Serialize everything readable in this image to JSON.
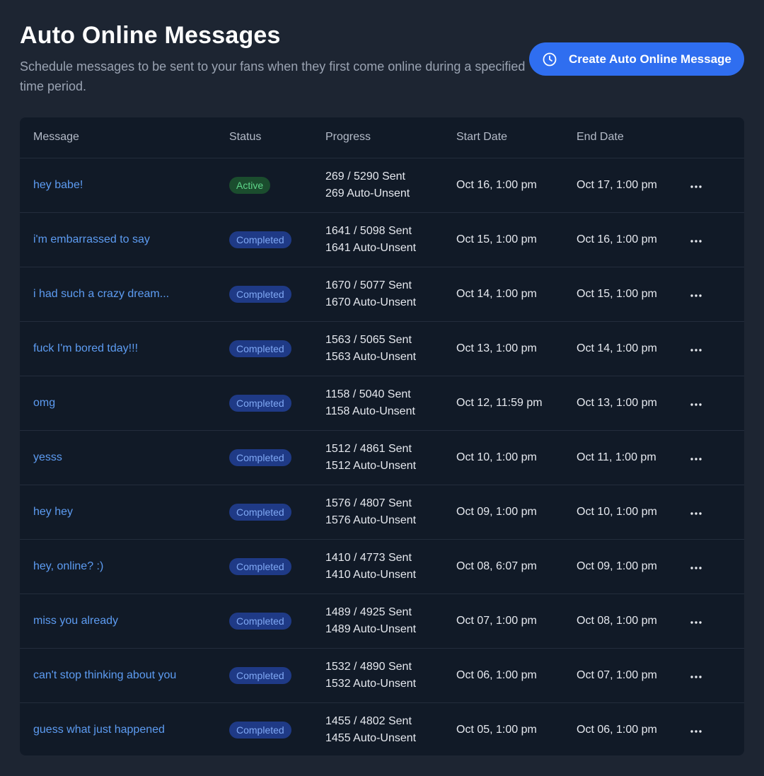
{
  "header": {
    "title": "Auto Online Messages",
    "subtitle": "Schedule messages to be sent to your fans when they first come online during a specified time period.",
    "create_button_label": "Create Auto Online Message"
  },
  "colors": {
    "accent": "#2f6ef0",
    "link": "#5d9cf2",
    "active_bg": "#1b4d2e",
    "active_text": "#5fd68a",
    "completed_bg": "#1f3a86",
    "completed_text": "#7fa8f4"
  },
  "table": {
    "columns": [
      "Message",
      "Status",
      "Progress",
      "Start Date",
      "End Date"
    ],
    "rows": [
      {
        "message": "hey babe!",
        "status": "Active",
        "sent": "269 / 5290 Sent",
        "unsent": "269 Auto-Unsent",
        "start": "Oct 16, 1:00 pm",
        "end": "Oct 17, 1:00 pm"
      },
      {
        "message": "i'm embarrassed to say",
        "status": "Completed",
        "sent": "1641 / 5098 Sent",
        "unsent": "1641 Auto-Unsent",
        "start": "Oct 15, 1:00 pm",
        "end": "Oct 16, 1:00 pm"
      },
      {
        "message": "i had such a crazy dream...",
        "status": "Completed",
        "sent": "1670 / 5077 Sent",
        "unsent": "1670 Auto-Unsent",
        "start": "Oct 14, 1:00 pm",
        "end": "Oct 15, 1:00 pm"
      },
      {
        "message": "fuck I'm bored tday!!!",
        "status": "Completed",
        "sent": "1563 / 5065 Sent",
        "unsent": "1563 Auto-Unsent",
        "start": "Oct 13, 1:00 pm",
        "end": "Oct 14, 1:00 pm"
      },
      {
        "message": "omg",
        "status": "Completed",
        "sent": "1158 / 5040 Sent",
        "unsent": "1158 Auto-Unsent",
        "start": "Oct 12, 11:59 pm",
        "end": "Oct 13, 1:00 pm"
      },
      {
        "message": "yesss",
        "status": "Completed",
        "sent": "1512 / 4861 Sent",
        "unsent": "1512 Auto-Unsent",
        "start": "Oct 10, 1:00 pm",
        "end": "Oct 11, 1:00 pm"
      },
      {
        "message": "hey hey",
        "status": "Completed",
        "sent": "1576 / 4807 Sent",
        "unsent": "1576 Auto-Unsent",
        "start": "Oct 09, 1:00 pm",
        "end": "Oct 10, 1:00 pm"
      },
      {
        "message": "hey, online? :)",
        "status": "Completed",
        "sent": "1410 / 4773 Sent",
        "unsent": "1410 Auto-Unsent",
        "start": "Oct 08, 6:07 pm",
        "end": "Oct 09, 1:00 pm"
      },
      {
        "message": "miss you already",
        "status": "Completed",
        "sent": "1489 / 4925 Sent",
        "unsent": "1489 Auto-Unsent",
        "start": "Oct 07, 1:00 pm",
        "end": "Oct 08, 1:00 pm"
      },
      {
        "message": "can't stop thinking about you",
        "status": "Completed",
        "sent": "1532 / 4890 Sent",
        "unsent": "1532 Auto-Unsent",
        "start": "Oct 06, 1:00 pm",
        "end": "Oct 07, 1:00 pm"
      },
      {
        "message": "guess what just happened",
        "status": "Completed",
        "sent": "1455 / 4802 Sent",
        "unsent": "1455 Auto-Unsent",
        "start": "Oct 05, 1:00 pm",
        "end": "Oct 06, 1:00 pm"
      }
    ]
  },
  "icons": {
    "create_button": "clock-icon",
    "row_actions": "more-horizontal-icon"
  }
}
